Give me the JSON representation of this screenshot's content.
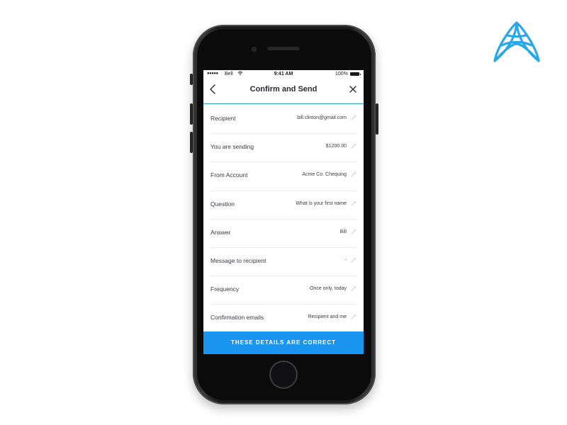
{
  "status_bar": {
    "signal": "●●●●●",
    "carrier": "Bell",
    "time": "9:41 AM",
    "battery_pct": "100%"
  },
  "nav": {
    "title": "Confirm and Send"
  },
  "rows": [
    {
      "label": "Recipient",
      "value": "bill.clinton@gmail.com"
    },
    {
      "label": "You are sending",
      "value": "$1200.00"
    },
    {
      "label": "From Account",
      "value": "Acme Co. Chequing"
    },
    {
      "label": "Question",
      "value": "What is your first name"
    },
    {
      "label": "Answer",
      "value": "Bill"
    },
    {
      "label": "Message to recipient",
      "value": "-"
    },
    {
      "label": "Frequency",
      "value": "Once only, today"
    },
    {
      "label": "Confirmation emails",
      "value": "Recipient and me"
    }
  ],
  "confirm_button_label": "THESE DETAILS ARE CORRECT",
  "colors": {
    "accent": "#1a96f0",
    "divider_accent": "#29a3e0",
    "logo": "#2aa7e8",
    "text": "#3a3a44"
  },
  "icons": {
    "back": "chevron-left-icon",
    "close": "close-icon",
    "edit": "pencil-icon",
    "wifi": "wifi-icon",
    "battery": "battery-icon",
    "brand": "brand-logo-icon"
  }
}
